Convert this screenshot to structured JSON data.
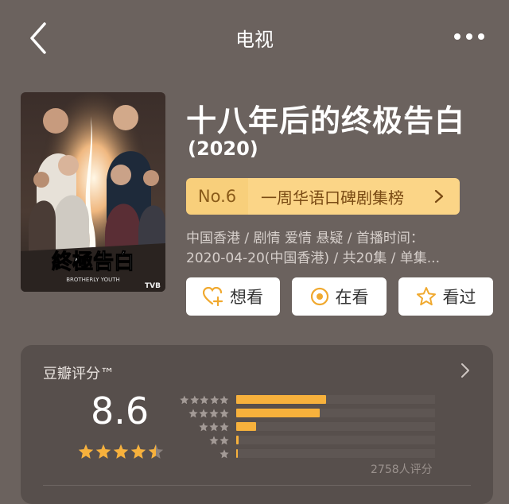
{
  "header": {
    "title": "电视"
  },
  "show": {
    "title": "十八年后的终极告白",
    "year": "(2020)",
    "poster_title": "終極告白",
    "poster_subtitle": "BROTHERLY YOUTH",
    "poster_logo": "TVB",
    "rank": {
      "no": "No.6",
      "list": "一周华语口碑剧集榜"
    },
    "meta_line1": "中国香港 / 剧情 爱情 悬疑 / 首播时间：",
    "meta_line2": "2020-04-20(中国香港) / 共20集 / 单集..."
  },
  "actions": {
    "want": "想看",
    "watching": "在看",
    "watched": "看过"
  },
  "rating": {
    "label": "豆瓣评分™",
    "score": "8.6",
    "stars": 4.5,
    "count_text": "2758人评分",
    "distribution": [
      {
        "stars": 5,
        "fraction": 0.45
      },
      {
        "stars": 4,
        "fraction": 0.42
      },
      {
        "stars": 3,
        "fraction": 0.1
      },
      {
        "stars": 2,
        "fraction": 0.01
      },
      {
        "stars": 1,
        "fraction": 0.005
      }
    ]
  },
  "colors": {
    "background": "#6b625e",
    "card": "#574f4c",
    "accent": "#f7b13c",
    "rank_badge": "#fbd587"
  },
  "icons": {
    "back": "back-arrow-icon",
    "more": "more-dots-icon",
    "want": "heart-plus-icon",
    "watching": "circle-dot-icon",
    "watched": "star-outline-icon"
  }
}
